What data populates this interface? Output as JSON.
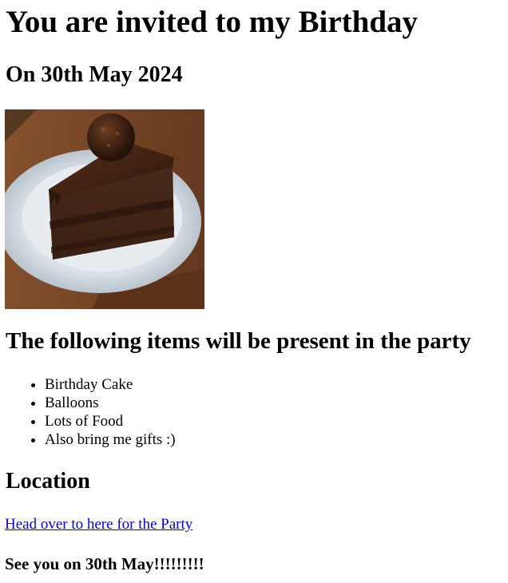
{
  "page": {
    "title": "You are invited to my Birthday",
    "date_heading": "On 30th May 2024",
    "image_alt": "chocolate cake slice",
    "items_heading": "The following items will be present in the party",
    "items": [
      "Birthday Cake",
      "Balloons",
      "Lots of Food",
      "Also bring me gifts :)"
    ],
    "location_heading": "Location",
    "location_link": "Head over to here for the Party",
    "closing": "See you on 30th May!!!!!!!!!"
  }
}
